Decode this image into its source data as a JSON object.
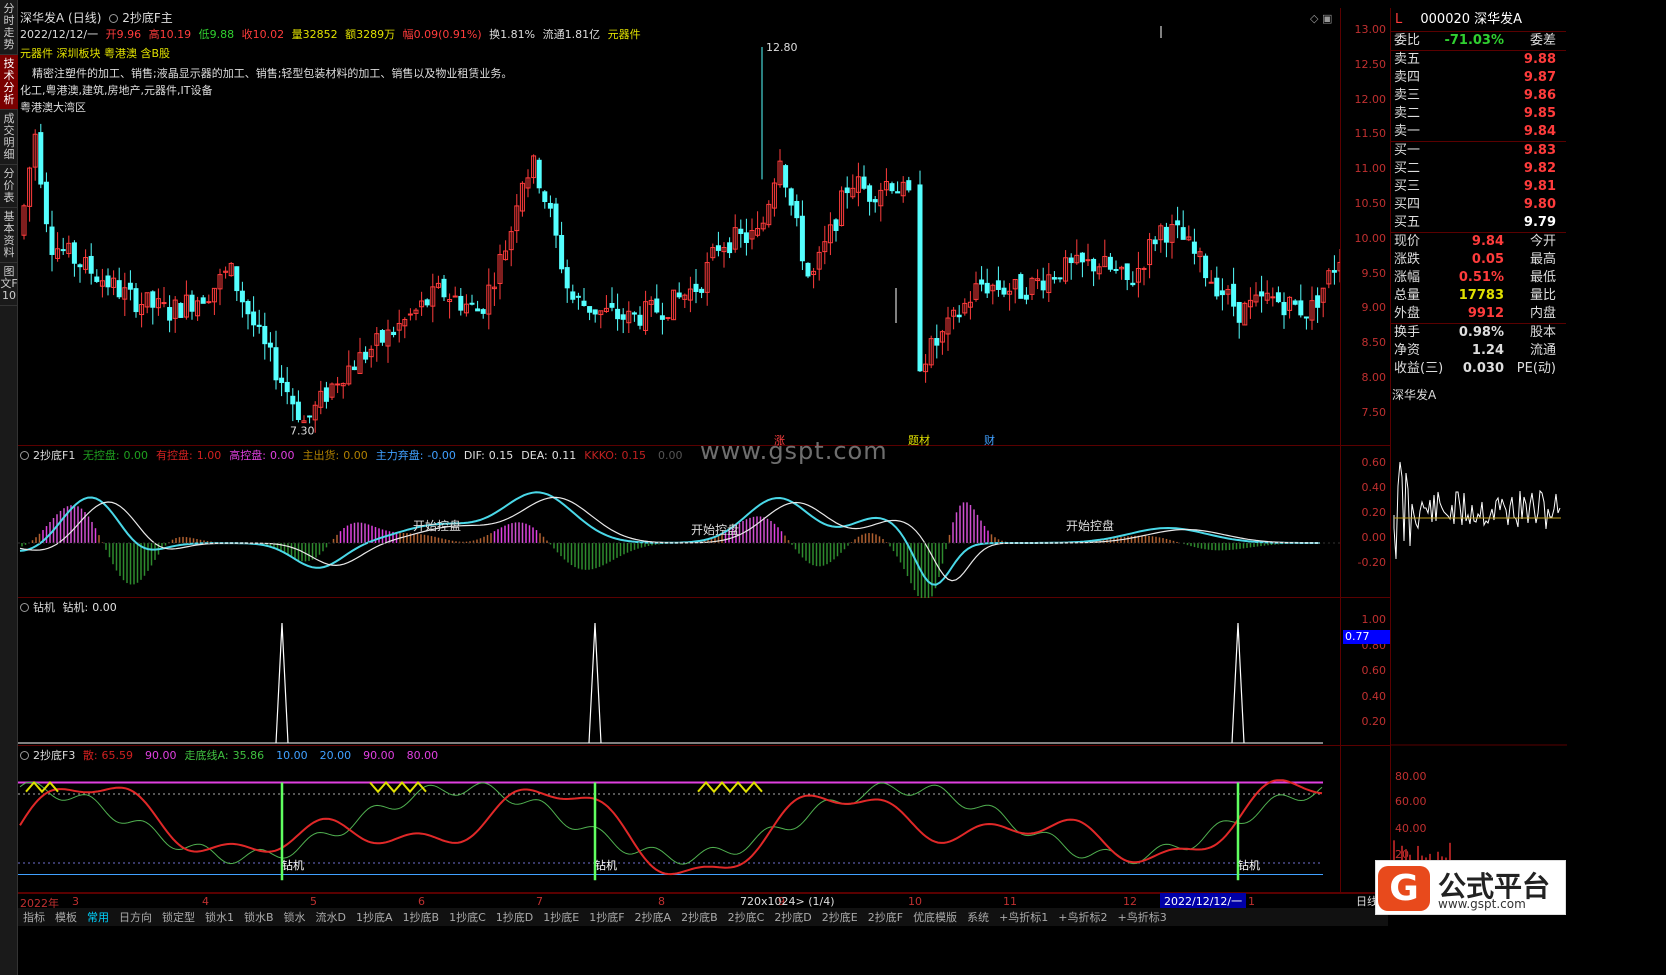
{
  "left_tabs": [
    "分时走势",
    "技术分析",
    "成交明细",
    "分价表",
    "基本资料",
    "图文F10"
  ],
  "header": {
    "stock_title": "深华发A (日线)",
    "formula": "2抄底F主",
    "line2_date": "2022/12/12/一",
    "line2_open": "开9.96",
    "line2_high": "高10.19",
    "line2_low": "低9.88",
    "line2_close": "收10.02",
    "line2_vol": "量32852",
    "line2_amount": "额3289万",
    "line2_change": "幅0.09(0.91%)",
    "line2_turnover": "换1.81%",
    "line2_float": "流通1.81亿",
    "line2_sector": "元器件",
    "tags": "元器件 深圳板块 粤港澳 含B股",
    "desc1": "精密注塑件的加工、销售;液晶显示器的加工、销售;轻型包装材料的加工、销售以及物业租赁业务。",
    "desc2": "化工,粤港澳,建筑,房地产,元器件,IT设备",
    "desc3": "粤港澳大湾区",
    "high_mark": "12.80",
    "low_mark": "7.30",
    "event_zhang": "涨",
    "event_ticai": "题材",
    "event_cai": "财"
  },
  "main_yticks": [
    "13.00",
    "12.50",
    "12.00",
    "11.50",
    "11.00",
    "10.50",
    "10.00",
    "9.50",
    "9.00",
    "8.50",
    "8.00",
    "7.50"
  ],
  "f1": {
    "title": "2抄底F1",
    "items": [
      {
        "label": "无控盘:",
        "value": "0.00",
        "color": "#1fa01f"
      },
      {
        "label": "有控盘:",
        "value": "1.00",
        "color": "#d02020"
      },
      {
        "label": "高控盘:",
        "value": "0.00",
        "color": "#e040e0"
      },
      {
        "label": "主出货:",
        "value": "0.00",
        "color": "#b08000"
      },
      {
        "label": "主力弃盘:",
        "value": "-0.00",
        "color": "#40a0ff"
      },
      {
        "label": "DIF:",
        "value": "0.15",
        "color": "#e0e0e0"
      },
      {
        "label": "DEA:",
        "value": "0.11",
        "color": "#e0e0e0"
      },
      {
        "label": "KKKO:",
        "value": "0.15",
        "color": "#c02020"
      },
      {
        "label": "",
        "value": "0.00",
        "color": "#555"
      }
    ],
    "yticks": [
      "0.60",
      "0.40",
      "0.20",
      "0.00",
      "-0.20"
    ],
    "start_labels": [
      "开始控盘",
      "开始控盘",
      "开始控盘"
    ]
  },
  "f2": {
    "title": "钻机",
    "items": [
      {
        "label": "钻机:",
        "value": "0.00",
        "color": "#e0e0e0"
      }
    ],
    "yticks": [
      "1.00",
      "0.80",
      "0.60",
      "0.40",
      "0.20"
    ],
    "current_value": "0.77"
  },
  "f3": {
    "title": "2抄底F3",
    "items": [
      {
        "label": "散:",
        "value": "65.59",
        "color": "#d02020"
      },
      {
        "label": "",
        "value": "90.00",
        "color": "#e040e0"
      },
      {
        "label": "走底线A:",
        "value": "35.86",
        "color": "#40c040"
      },
      {
        "label": "",
        "value": "10.00",
        "color": "#40a0ff"
      },
      {
        "label": "",
        "value": "20.00",
        "color": "#40a0ff"
      },
      {
        "label": "",
        "value": "90.00",
        "color": "#e040e0"
      },
      {
        "label": "",
        "value": "80.00",
        "color": "#e040e0"
      }
    ],
    "drill_labels": [
      "钻机",
      "钻机",
      "钻机"
    ]
  },
  "quote": {
    "code_line": "000020 深华发A",
    "prefix": "L",
    "rows_top": [
      {
        "l": "委比",
        "v": "-71.03%",
        "r": "委差",
        "vcolor": "#30d030"
      }
    ],
    "sell": [
      {
        "l": "卖五",
        "v": "9.88"
      },
      {
        "l": "卖四",
        "v": "9.87"
      },
      {
        "l": "卖三",
        "v": "9.86"
      },
      {
        "l": "卖二",
        "v": "9.85"
      },
      {
        "l": "卖一",
        "v": "9.84"
      }
    ],
    "buy": [
      {
        "l": "买一",
        "v": "9.83"
      },
      {
        "l": "买二",
        "v": "9.82"
      },
      {
        "l": "买三",
        "v": "9.81"
      },
      {
        "l": "买四",
        "v": "9.80"
      },
      {
        "l": "买五",
        "v": "9.79"
      }
    ],
    "stats": [
      {
        "l": "现价",
        "v": "9.84",
        "r": "今开",
        "vcolor": "#ff3c3c"
      },
      {
        "l": "涨跌",
        "v": "0.05",
        "r": "最高",
        "vcolor": "#ff3c3c"
      },
      {
        "l": "涨幅",
        "v": "0.51%",
        "r": "最低",
        "vcolor": "#ff3c3c"
      },
      {
        "l": "总量",
        "v": "17783",
        "r": "量比",
        "vcolor": "#e0e000"
      },
      {
        "l": "外盘",
        "v": "9912",
        "r": "内盘",
        "vcolor": "#ff3c3c"
      }
    ],
    "stats2": [
      {
        "l": "换手",
        "v": "0.98%",
        "r": "股本",
        "vcolor": "#ddd"
      },
      {
        "l": "净资",
        "v": "1.24",
        "r": "流通",
        "vcolor": "#ddd"
      },
      {
        "l": "收益(三)",
        "v": "0.030",
        "r": "PE(动)",
        "vcolor": "#ddd"
      }
    ],
    "stock_label": "深华发A"
  },
  "mini_yticks": [
    "0.60",
    "0.40",
    "0.20",
    "0.00",
    "-0.20"
  ],
  "mini_yticks2": [
    "80.00",
    "60.00",
    "40.00",
    "20"
  ],
  "date_axis": [
    "2022年",
    "3",
    "4",
    "5",
    "6",
    "7",
    "8",
    "9",
    "10",
    "11",
    "12",
    "1"
  ],
  "date_badge": "2022/12/12/一",
  "scroll_info": "720x1024> (1/4)",
  "day_label": "日线",
  "bottom_tabs": [
    "指标",
    "模板",
    "常用",
    "日方向",
    "锁定型",
    "锁水1",
    "锁水B",
    "锁水",
    "流水D",
    "1抄底A",
    "1抄底B",
    "1抄底C",
    "1抄底D",
    "1抄底E",
    "1抄底F",
    "2抄底A",
    "2抄底B",
    "2抄底C",
    "2抄底D",
    "2抄底E",
    "2抄底F",
    "优底模版",
    "系统",
    "+鸟折标1",
    "+鸟折标2",
    "+鸟折标3"
  ],
  "watermark": "www.gspt.com",
  "logo": {
    "title": "公式平台",
    "url": "www.gspt.com",
    "glyph": "G"
  }
}
